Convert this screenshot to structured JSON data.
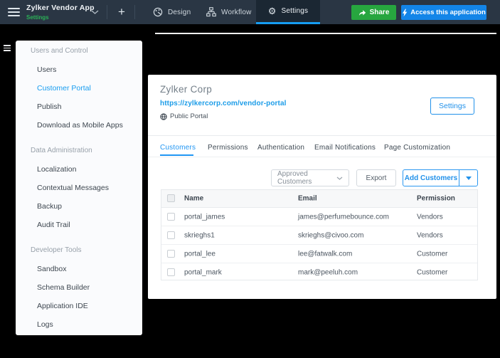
{
  "topbar": {
    "app_title": "Zylker Vendor App",
    "app_subtitle": "Settings",
    "plus_label": "+",
    "nav": [
      {
        "label": "Design"
      },
      {
        "label": "Workflow"
      },
      {
        "label": "Settings"
      }
    ],
    "share_label": "Share",
    "access_label": "Access this application"
  },
  "colors": {
    "bar_bg": "#2a3644",
    "active_tab_bg": "#1b2733",
    "tab_underline_blue": "#169df2",
    "subtitle_green": "#2bb157",
    "share_green": "#27a63f",
    "access_blue": "#1385e8",
    "accent_blue": "#2196f3",
    "link_blue": "#1b9ce8",
    "sidebar_active_blue": "#189df0"
  },
  "sidebar": {
    "sections": [
      {
        "header": "Users and Control",
        "items": [
          {
            "label": "Users"
          },
          {
            "label": "Customer Portal"
          },
          {
            "label": "Publish"
          },
          {
            "label": "Download as Mobile Apps"
          }
        ]
      },
      {
        "header": "Data Administration",
        "items": [
          {
            "label": "Localization"
          },
          {
            "label": "Contextual Messages"
          },
          {
            "label": "Backup"
          },
          {
            "label": "Audit Trail"
          }
        ]
      },
      {
        "header": "Developer Tools",
        "items": [
          {
            "label": "Sandbox"
          },
          {
            "label": "Schema Builder"
          },
          {
            "label": "Application IDE"
          },
          {
            "label": "Logs"
          }
        ]
      }
    ],
    "active_item": "Customer Portal"
  },
  "portal": {
    "company": "Zylker Corp",
    "url": "https://zylkercorp.com/vendor-portal",
    "visibility": "Public Portal",
    "settings_button": "Settings",
    "tabs": [
      {
        "label": "Customers"
      },
      {
        "label": "Permissions"
      },
      {
        "label": "Authentication"
      },
      {
        "label": "Email Notifications"
      },
      {
        "label": "Page Customization"
      }
    ],
    "active_tab": "Customers",
    "toolbar": {
      "filter_value": "Approved Customers",
      "export_label": "Export",
      "add_label": "Add Customers"
    },
    "table": {
      "columns": {
        "name": "Name",
        "email": "Email",
        "permission": "Permission"
      },
      "rows": [
        {
          "name": "portal_james",
          "email": "james@perfumebounce.com",
          "permission": "Vendors"
        },
        {
          "name": "skrieghs1",
          "email": "skrieghs@civoo.com",
          "permission": "Vendors"
        },
        {
          "name": "portal_lee",
          "email": "lee@fatwalk.com",
          "permission": "Customer"
        },
        {
          "name": "portal_mark",
          "email": "mark@peeluh.com",
          "permission": "Customer"
        }
      ]
    }
  }
}
